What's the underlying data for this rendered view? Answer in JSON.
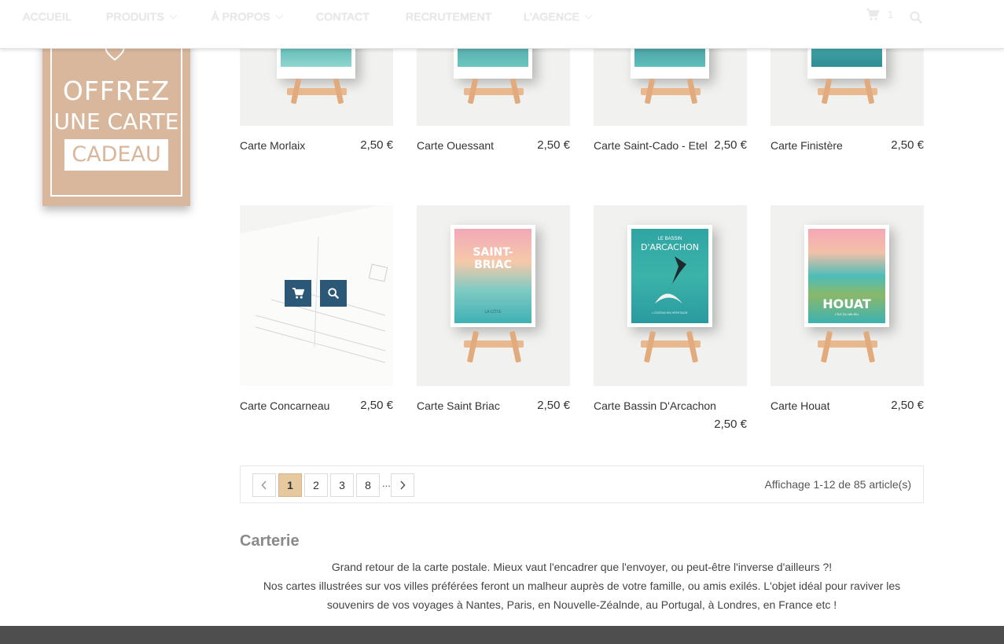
{
  "nav": {
    "items": [
      {
        "label": "ACCUEIL"
      },
      {
        "label": "PRODUITS"
      },
      {
        "label": "À PROPOS"
      },
      {
        "label": "CONTACT"
      },
      {
        "label": "RECRUTEMENT"
      },
      {
        "label": "L'AGENCE"
      }
    ],
    "cart_count": "1"
  },
  "gift_card": {
    "line1": "OFFREZ",
    "line2": "UNE CARTE",
    "line3": "CADEAU"
  },
  "products": [
    {
      "name": "Carte Morlaix",
      "price": "2,50 €"
    },
    {
      "name": "Carte Ouessant",
      "price": "2,50 €"
    },
    {
      "name": "Carte Saint-Cado - Etel",
      "price": "2,50 €"
    },
    {
      "name": "Carte Finistère",
      "price": "2,50 €"
    },
    {
      "name": "Carte Concarneau",
      "price": "2,50 €"
    },
    {
      "name": "Carte Saint Briac",
      "price": "2,50 €"
    },
    {
      "name": "Carte Bassin D'Arcachon",
      "price": "2,50 €"
    },
    {
      "name": "Carte Houat",
      "price": "2,50 €"
    }
  ],
  "posters": {
    "saint_briac": {
      "title": "SAINT-BRIAC",
      "sub": "LA CÔTE"
    },
    "arcachon": {
      "top": "LE BASSIN",
      "title": "D'ARCACHON",
      "sub": "L'OCÉAN EN HÉRITAGE"
    },
    "houat": {
      "title": "HOUAT",
      "sub": "L'ÎLE DU MILIEU"
    }
  },
  "pagination": {
    "pages": [
      "1",
      "2",
      "3",
      "8"
    ],
    "dots": "...",
    "current": "1",
    "info": "Affichage 1-12 de 85 article(s)"
  },
  "category": {
    "title": "Carterie",
    "line1": "Grand retour de la carte postale. Mieux vaut l'encadrer que l'envoyer, ou peut-être l'inverse d'ailleurs ?!",
    "line2": "Nos cartes illustrées sur vos villes préférées feront un malheur auprès de votre famille, ou amis exilés. L'objet idéal pour raviver les souvenirs de vos voyages à Nantes, Paris, en Nouvelle-Zéalnde, au Portugal, à Londres, en France etc !"
  },
  "colors": {
    "accent": "#2b5877",
    "active_page": "#e7c9a0",
    "gift_bg": "#d8b79c",
    "footer": "#4e4e4e"
  },
  "icons": [
    "chevron-down-icon",
    "cart-icon",
    "search-icon",
    "chevron-left-icon",
    "chevron-right-icon",
    "heart-icon"
  ]
}
